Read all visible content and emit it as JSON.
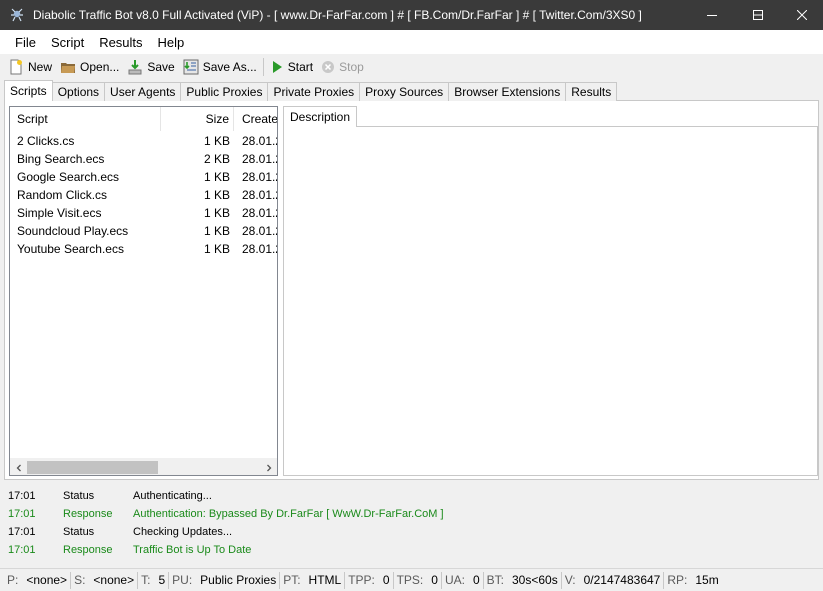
{
  "window": {
    "title": "Diabolic Traffic Bot v8.0 Full Activated (ViP) - [ www.Dr-FarFar.com ] # [ FB.Com/Dr.FarFar ] # [ Twitter.Com/3XS0 ]",
    "icon": "app-spider-icon"
  },
  "menu": [
    "File",
    "Script",
    "Results",
    "Help"
  ],
  "toolbar": {
    "new": "New",
    "open": "Open...",
    "save": "Save",
    "save_as": "Save As...",
    "start": "Start",
    "stop": "Stop"
  },
  "tabs": [
    "Scripts",
    "Options",
    "User Agents",
    "Public Proxies",
    "Private Proxies",
    "Proxy Sources",
    "Browser Extensions",
    "Results"
  ],
  "scripts": {
    "columns": [
      "Script",
      "Size",
      "Created"
    ],
    "rows": [
      {
        "name": "2 Clicks.cs",
        "size": "1 KB",
        "created": "28.01.2"
      },
      {
        "name": "Bing Search.ecs",
        "size": "2 KB",
        "created": "28.01.2"
      },
      {
        "name": "Google Search.ecs",
        "size": "1 KB",
        "created": "28.01.2"
      },
      {
        "name": "Random Click.cs",
        "size": "1 KB",
        "created": "28.01.2"
      },
      {
        "name": "Simple Visit.ecs",
        "size": "1 KB",
        "created": "28.01.2"
      },
      {
        "name": "Soundcloud Play.ecs",
        "size": "1 KB",
        "created": "28.01.2"
      },
      {
        "name": "Youtube Search.ecs",
        "size": "1 KB",
        "created": "28.01.2"
      }
    ]
  },
  "description_tab": "Description",
  "log": [
    {
      "time": "17:01",
      "type": "Status",
      "message": "Authenticating...",
      "kind": "status"
    },
    {
      "time": "17:01",
      "type": "Response",
      "message": "Authentication: Bypassed By Dr.FarFar [ WwW.Dr-FarFar.CoM ]",
      "kind": "response"
    },
    {
      "time": "17:01",
      "type": "Status",
      "message": "Checking Updates...",
      "kind": "status"
    },
    {
      "time": "17:01",
      "type": "Response",
      "message": "Traffic Bot is Up To Date",
      "kind": "response"
    }
  ],
  "status": [
    {
      "key": "P:",
      "value": "<none>"
    },
    {
      "key": "S:",
      "value": "<none>"
    },
    {
      "key": "T:",
      "value": "5"
    },
    {
      "key": "PU:",
      "value": "Public Proxies"
    },
    {
      "key": "PT:",
      "value": "HTML"
    },
    {
      "key": "TPP:",
      "value": "0"
    },
    {
      "key": "TPS:",
      "value": "0"
    },
    {
      "key": "UA:",
      "value": "0"
    },
    {
      "key": "BT:",
      "value": "30s<60s"
    },
    {
      "key": "V:",
      "value": "0/2147483647"
    },
    {
      "key": "RP:",
      "value": "15m"
    }
  ],
  "colors": {
    "titlebar": "#3a3a3a",
    "response_text": "#1a8a1a",
    "start_icon": "#2a9a2a"
  }
}
